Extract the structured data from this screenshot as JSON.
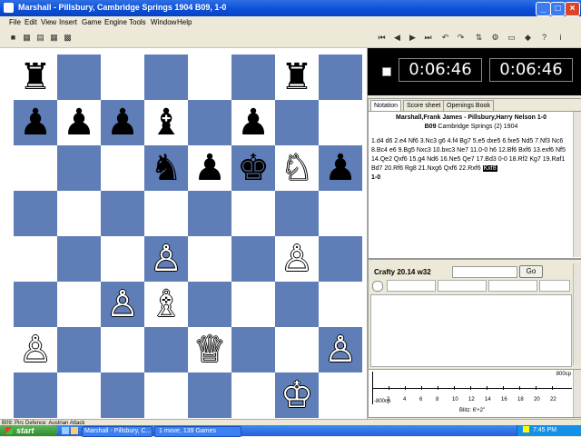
{
  "window": {
    "title": "Marshall - Pillsbury, Cambridge Springs 1904  B09, 1-0",
    "min_label": "_",
    "max_label": "□",
    "close_label": "×"
  },
  "menu": [
    "File",
    "Edit",
    "View",
    "Insert",
    "Game",
    "Engine",
    "Tools",
    "Window",
    "Help"
  ],
  "toolbar_right": [
    "⏮",
    "◀",
    "▶",
    "⏭",
    "↶",
    "↷"
  ],
  "clocks": {
    "white": "0:06:46",
    "black": "0:06:46"
  },
  "notation": {
    "tabs": [
      "Notation",
      "Score sheet",
      "Openings Book"
    ],
    "players": "Marshall,Frank James - Pillsbury,Harry Nelson  1-0",
    "event": "Cambridge Springs (2) 1904",
    "eco": "B09",
    "moves_text": "1.d4 d6 2.e4 Nf6 3.Nc3 g6 4.f4 Bg7 5.e5 dxe5 6.fxe5 Nd5 7.Nf3 Nc6 8.Bc4 e6 9.Bg5 Nxc3 10.bxc3 Ne7 11.0-0 h6 12.Bf6 Bxf6 13.exf6 Nf5 14.Qe2 Qxf6 15.g4 Nd6 16.Ne5 Qe7 17.Bd3 0-0 18.Rf2 Kg7 19.Raf1 Bd7 20.Rf6 Rg8 21.Nxg6 Qxf6 22.Rxf6",
    "current_move": "Kxf8",
    "result": "1-0"
  },
  "engine": {
    "name": "Crafty 20.14 w32",
    "go_label": "Go"
  },
  "graph": {
    "top_label": "800cp",
    "bottom_label": "-800cp",
    "ticks": [
      "2",
      "4",
      "6",
      "8",
      "10",
      "12",
      "14",
      "16",
      "18",
      "20",
      "22"
    ],
    "summary": "Blitz: 6'+2\""
  },
  "status": "B09: Pirc Defence: Austrian Attack",
  "taskbar": {
    "start": "start",
    "tasks": [
      "Marshall - Pillsbury, C...",
      "1 move, 139 Games"
    ],
    "time": "7:45 PM"
  },
  "board": {
    "light_color": "#ffffff",
    "dark_color": "#5f7db7",
    "pieces": [
      {
        "sq": "a8",
        "c": "b",
        "g": "♜"
      },
      {
        "sq": "g8",
        "c": "b",
        "g": "♜"
      },
      {
        "sq": "a7",
        "c": "b",
        "g": "♟"
      },
      {
        "sq": "b7",
        "c": "b",
        "g": "♟"
      },
      {
        "sq": "c7",
        "c": "b",
        "g": "♟"
      },
      {
        "sq": "d7",
        "c": "b",
        "g": "♝"
      },
      {
        "sq": "f7",
        "c": "b",
        "g": "♟"
      },
      {
        "sq": "d6",
        "c": "b",
        "g": "♞"
      },
      {
        "sq": "e6",
        "c": "b",
        "g": "♟"
      },
      {
        "sq": "f6",
        "c": "b",
        "g": "♚"
      },
      {
        "sq": "g6",
        "c": "w",
        "g": "♘"
      },
      {
        "sq": "h6",
        "c": "b",
        "g": "♟"
      },
      {
        "sq": "d4",
        "c": "w",
        "g": "♙"
      },
      {
        "sq": "g4",
        "c": "w",
        "g": "♙"
      },
      {
        "sq": "c3",
        "c": "w",
        "g": "♙"
      },
      {
        "sq": "d3",
        "c": "w",
        "g": "♗"
      },
      {
        "sq": "a2",
        "c": "w",
        "g": "♙"
      },
      {
        "sq": "e2",
        "c": "w",
        "g": "♕"
      },
      {
        "sq": "h2",
        "c": "w",
        "g": "♙"
      },
      {
        "sq": "g1",
        "c": "w",
        "g": "♔"
      }
    ]
  }
}
